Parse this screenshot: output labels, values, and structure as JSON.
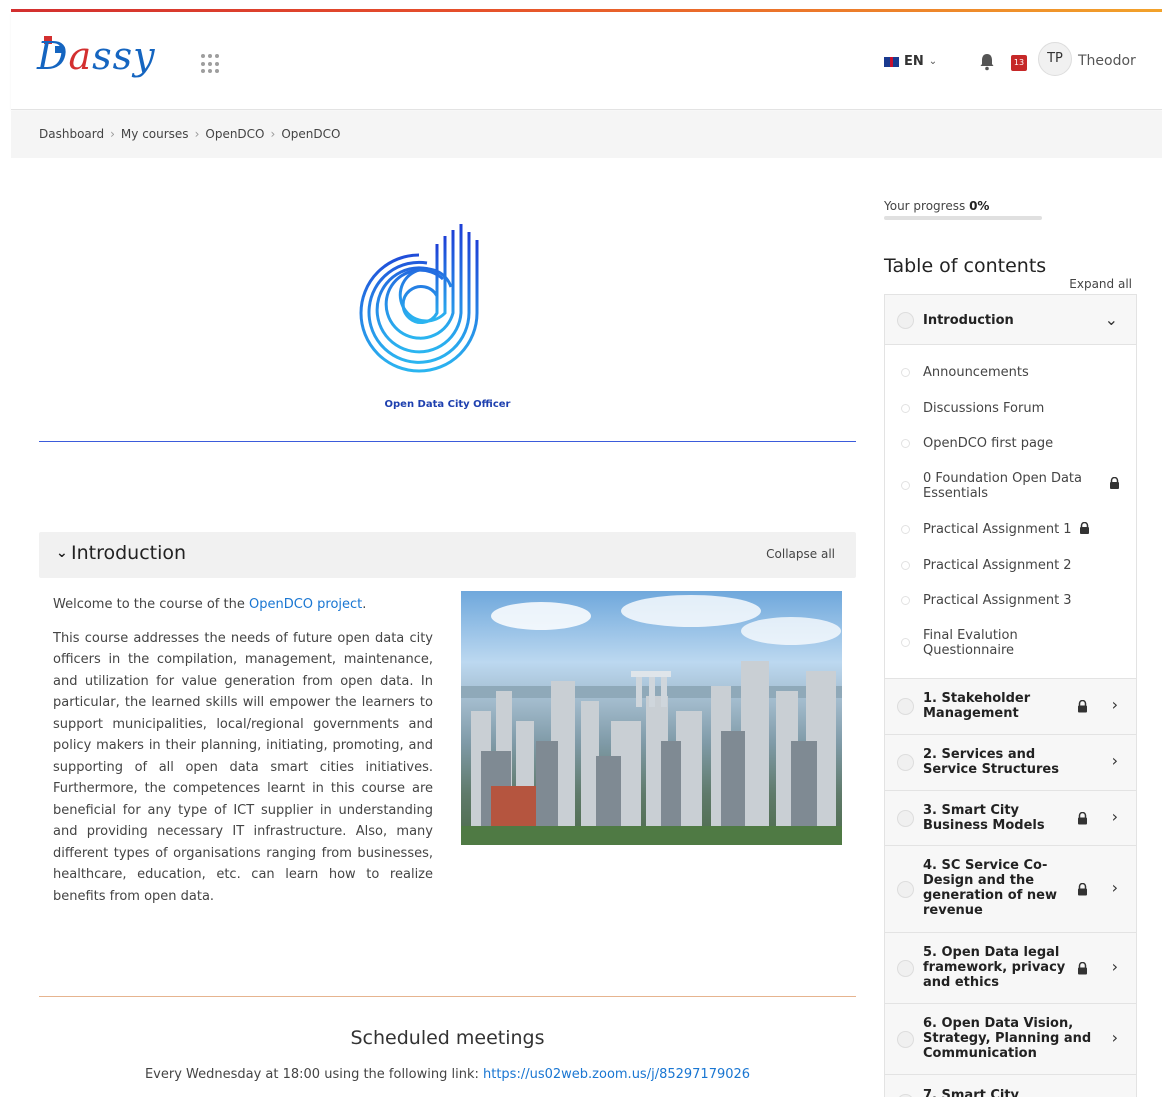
{
  "header": {
    "logo_text_left": "D",
    "logo_text_red": "a",
    "logo_text_right": "ssy",
    "language": "EN",
    "messages_count": "13",
    "user_initials": "TP",
    "user_name": "Theodor"
  },
  "breadcrumb": [
    "Dashboard",
    "My courses",
    "OpenDCO",
    "OpenDCO"
  ],
  "hero": {
    "caption": "Open Data City Officer"
  },
  "section": {
    "title": "Introduction",
    "collapse_label": "Collapse all"
  },
  "intro": {
    "welcome_prefix": "Welcome to the course of the ",
    "welcome_link": "OpenDCO project",
    "welcome_suffix": ".",
    "body": "This course addresses the needs of future open data city officers in the compilation, management, maintenance, and utilization for value generation from open data. In particular, the learned skills will empower the learners to support municipalities, local/regional governments and policy makers in their planning, initiating, promoting, and supporting of all open data smart cities initiatives. Furthermore, the competences learnt in this course are beneficial for any type of ICT supplier in understanding and providing necessary IT infrastructure. Also, many different types of organisations ranging from businesses, healthcare, education, etc. can learn how to realize benefits from open data."
  },
  "meetings": {
    "title": "Scheduled meetings",
    "text_prefix": "Every Wednesday at 18:00 using the following link: ",
    "link": "https://us02web.zoom.us/j/85297179026"
  },
  "sidebar": {
    "progress_label": "Your progress ",
    "progress_value": "0%",
    "progress_fraction": 0,
    "toc_title": "Table of contents",
    "expand_all": "Expand all",
    "intro_section": "Introduction",
    "intro_items": [
      "Announcements",
      "Discussions Forum",
      "OpenDCO first page",
      "0 Foundation Open Data Essentials",
      "Practical Assignment 1",
      "Practical Assignment 2",
      "Practical Assignment 3",
      "Final Evalution Questionnaire"
    ],
    "sections": [
      "1. Stakeholder Management",
      "2. Services and Service Structures",
      "3. Smart City Business Models",
      "4. SC Service Co-Design and the generation of new revenue",
      "5. Open Data legal framework, privacy and ethics",
      "6. Open Data Vision, Strategy, Planning and Communication",
      "7. Smart City"
    ]
  }
}
